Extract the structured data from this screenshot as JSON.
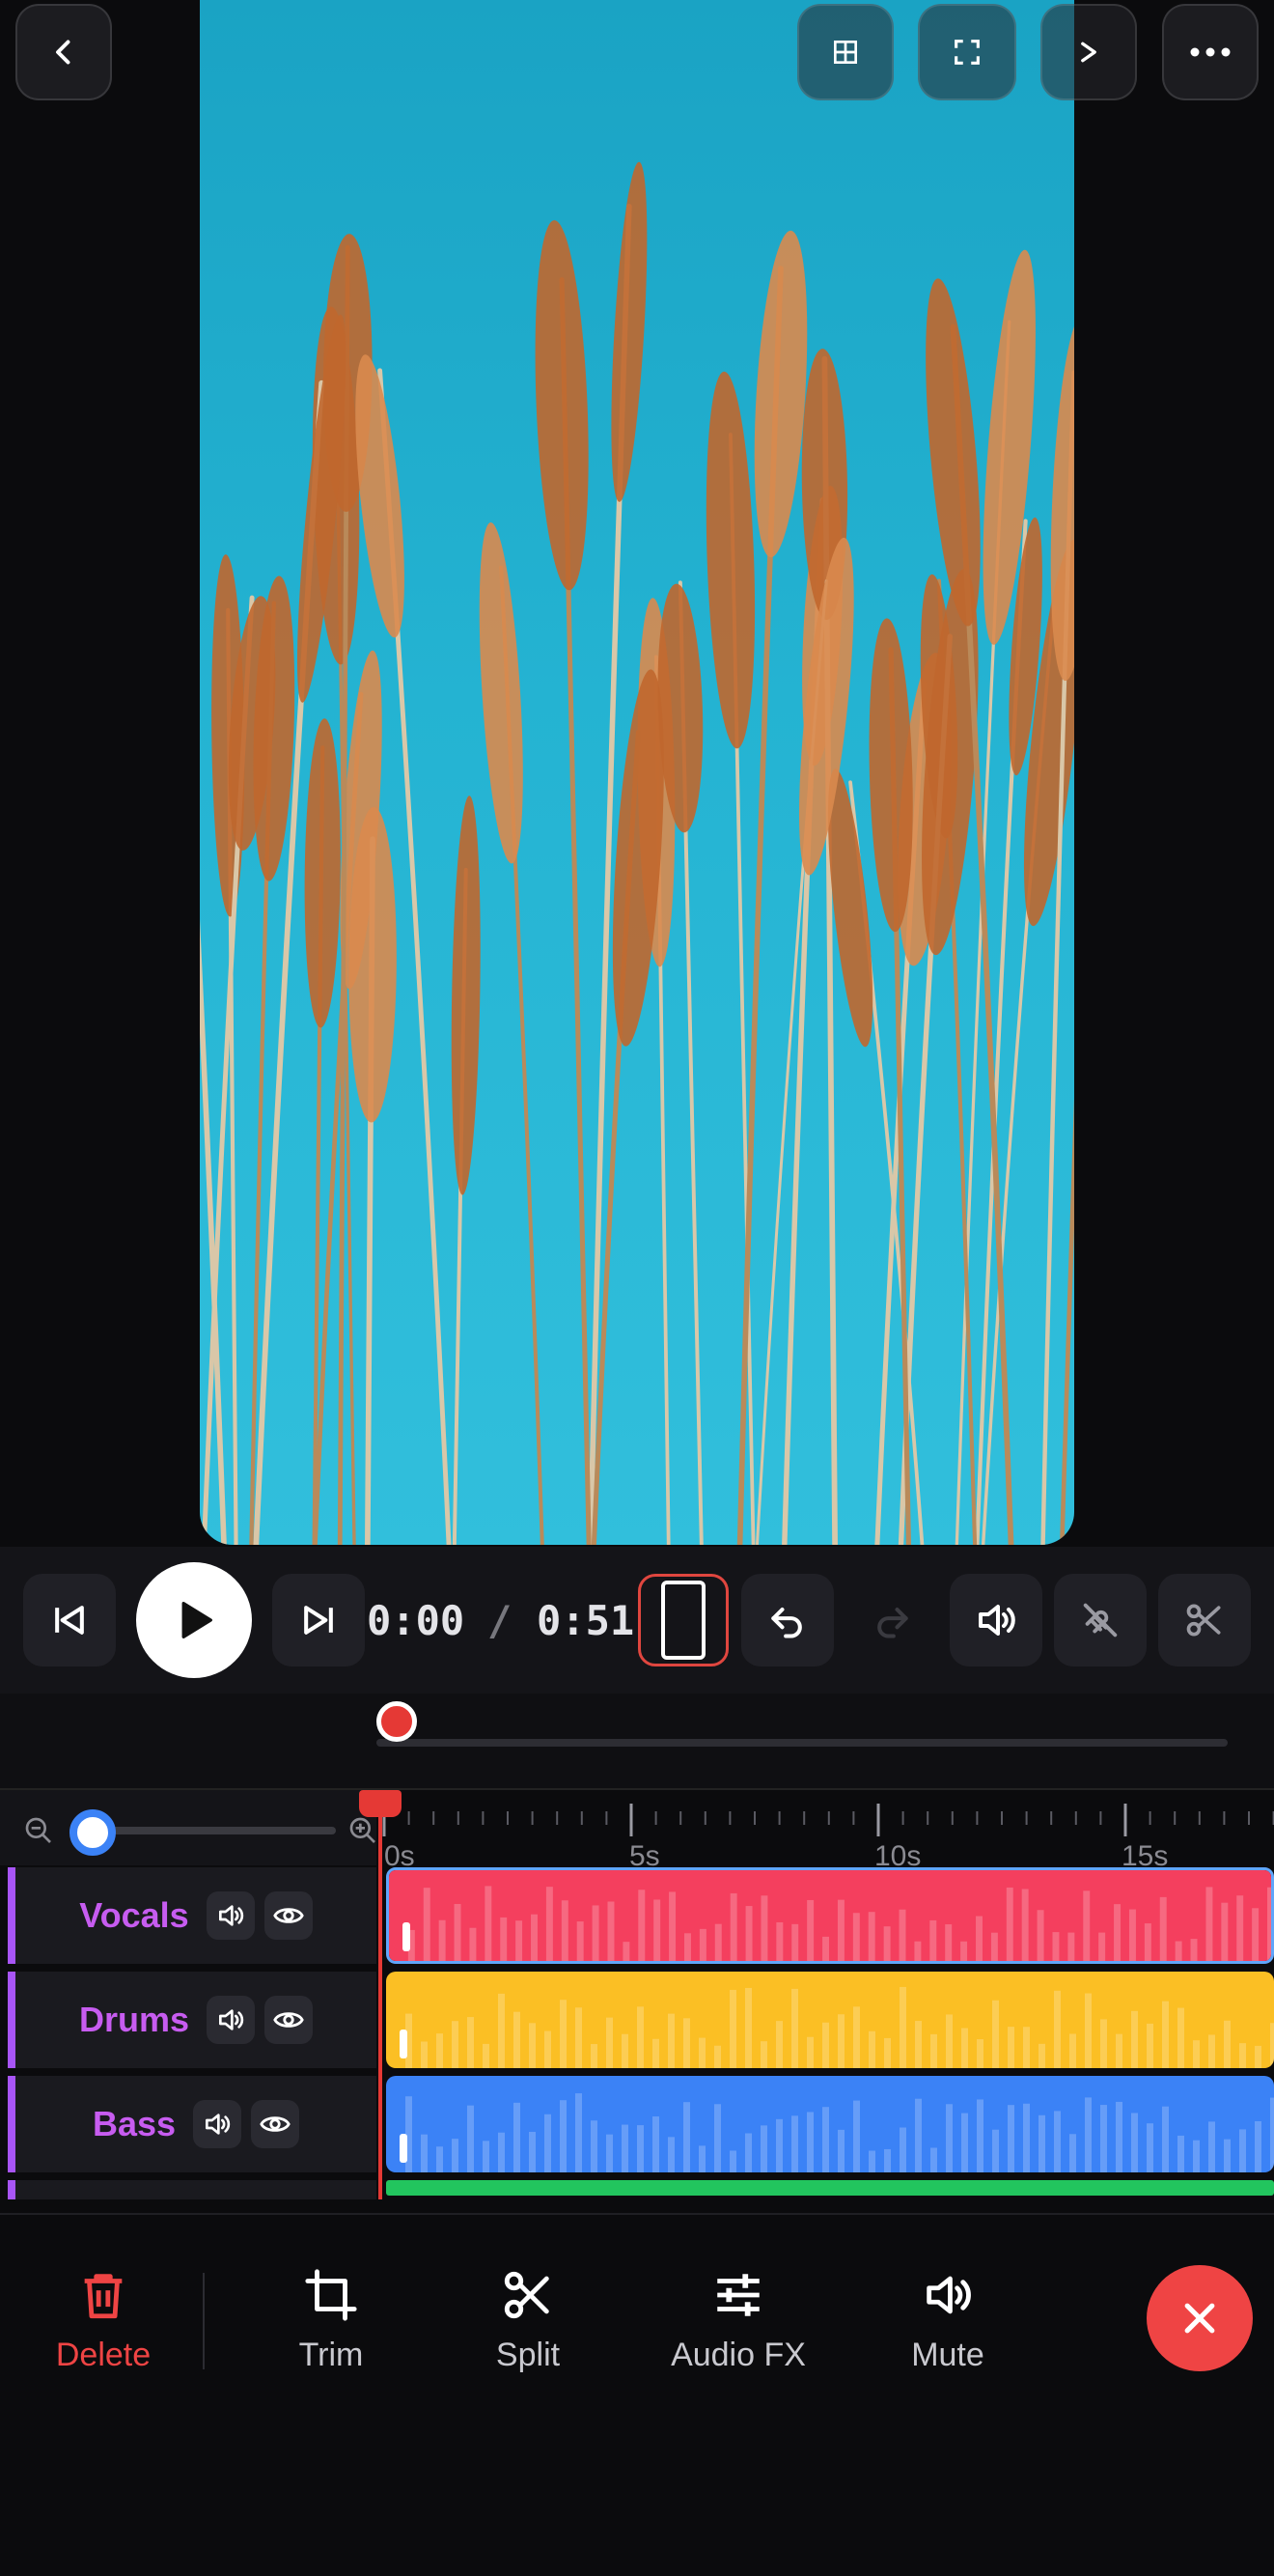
{
  "transport": {
    "current_time": "0:00",
    "separator": "/",
    "total_time": "0:51"
  },
  "ruler": {
    "labels": [
      "0s",
      "5s",
      "10s",
      "15s"
    ]
  },
  "tracks": [
    {
      "name": "Vocals",
      "color": "#f43f5e"
    },
    {
      "name": "Drums",
      "color": "#fbbf24"
    },
    {
      "name": "Bass",
      "color": "#3b82f6"
    }
  ],
  "toolbar": {
    "delete_label": "Delete",
    "trim_label": "Trim",
    "split_label": "Split",
    "audio_fx_label": "Audio FX",
    "mute_label": "Mute"
  },
  "colors": {
    "accent_red": "#ef4444",
    "track_label_purple": "#c75cf0",
    "hidden_track_green": "#22c55e"
  },
  "icons": {
    "back": "chevron-left-icon",
    "grid": "grid-icon",
    "fullscreen": "fullscreen-icon",
    "next": "chevron-right-icon",
    "more": "more-icon"
  }
}
